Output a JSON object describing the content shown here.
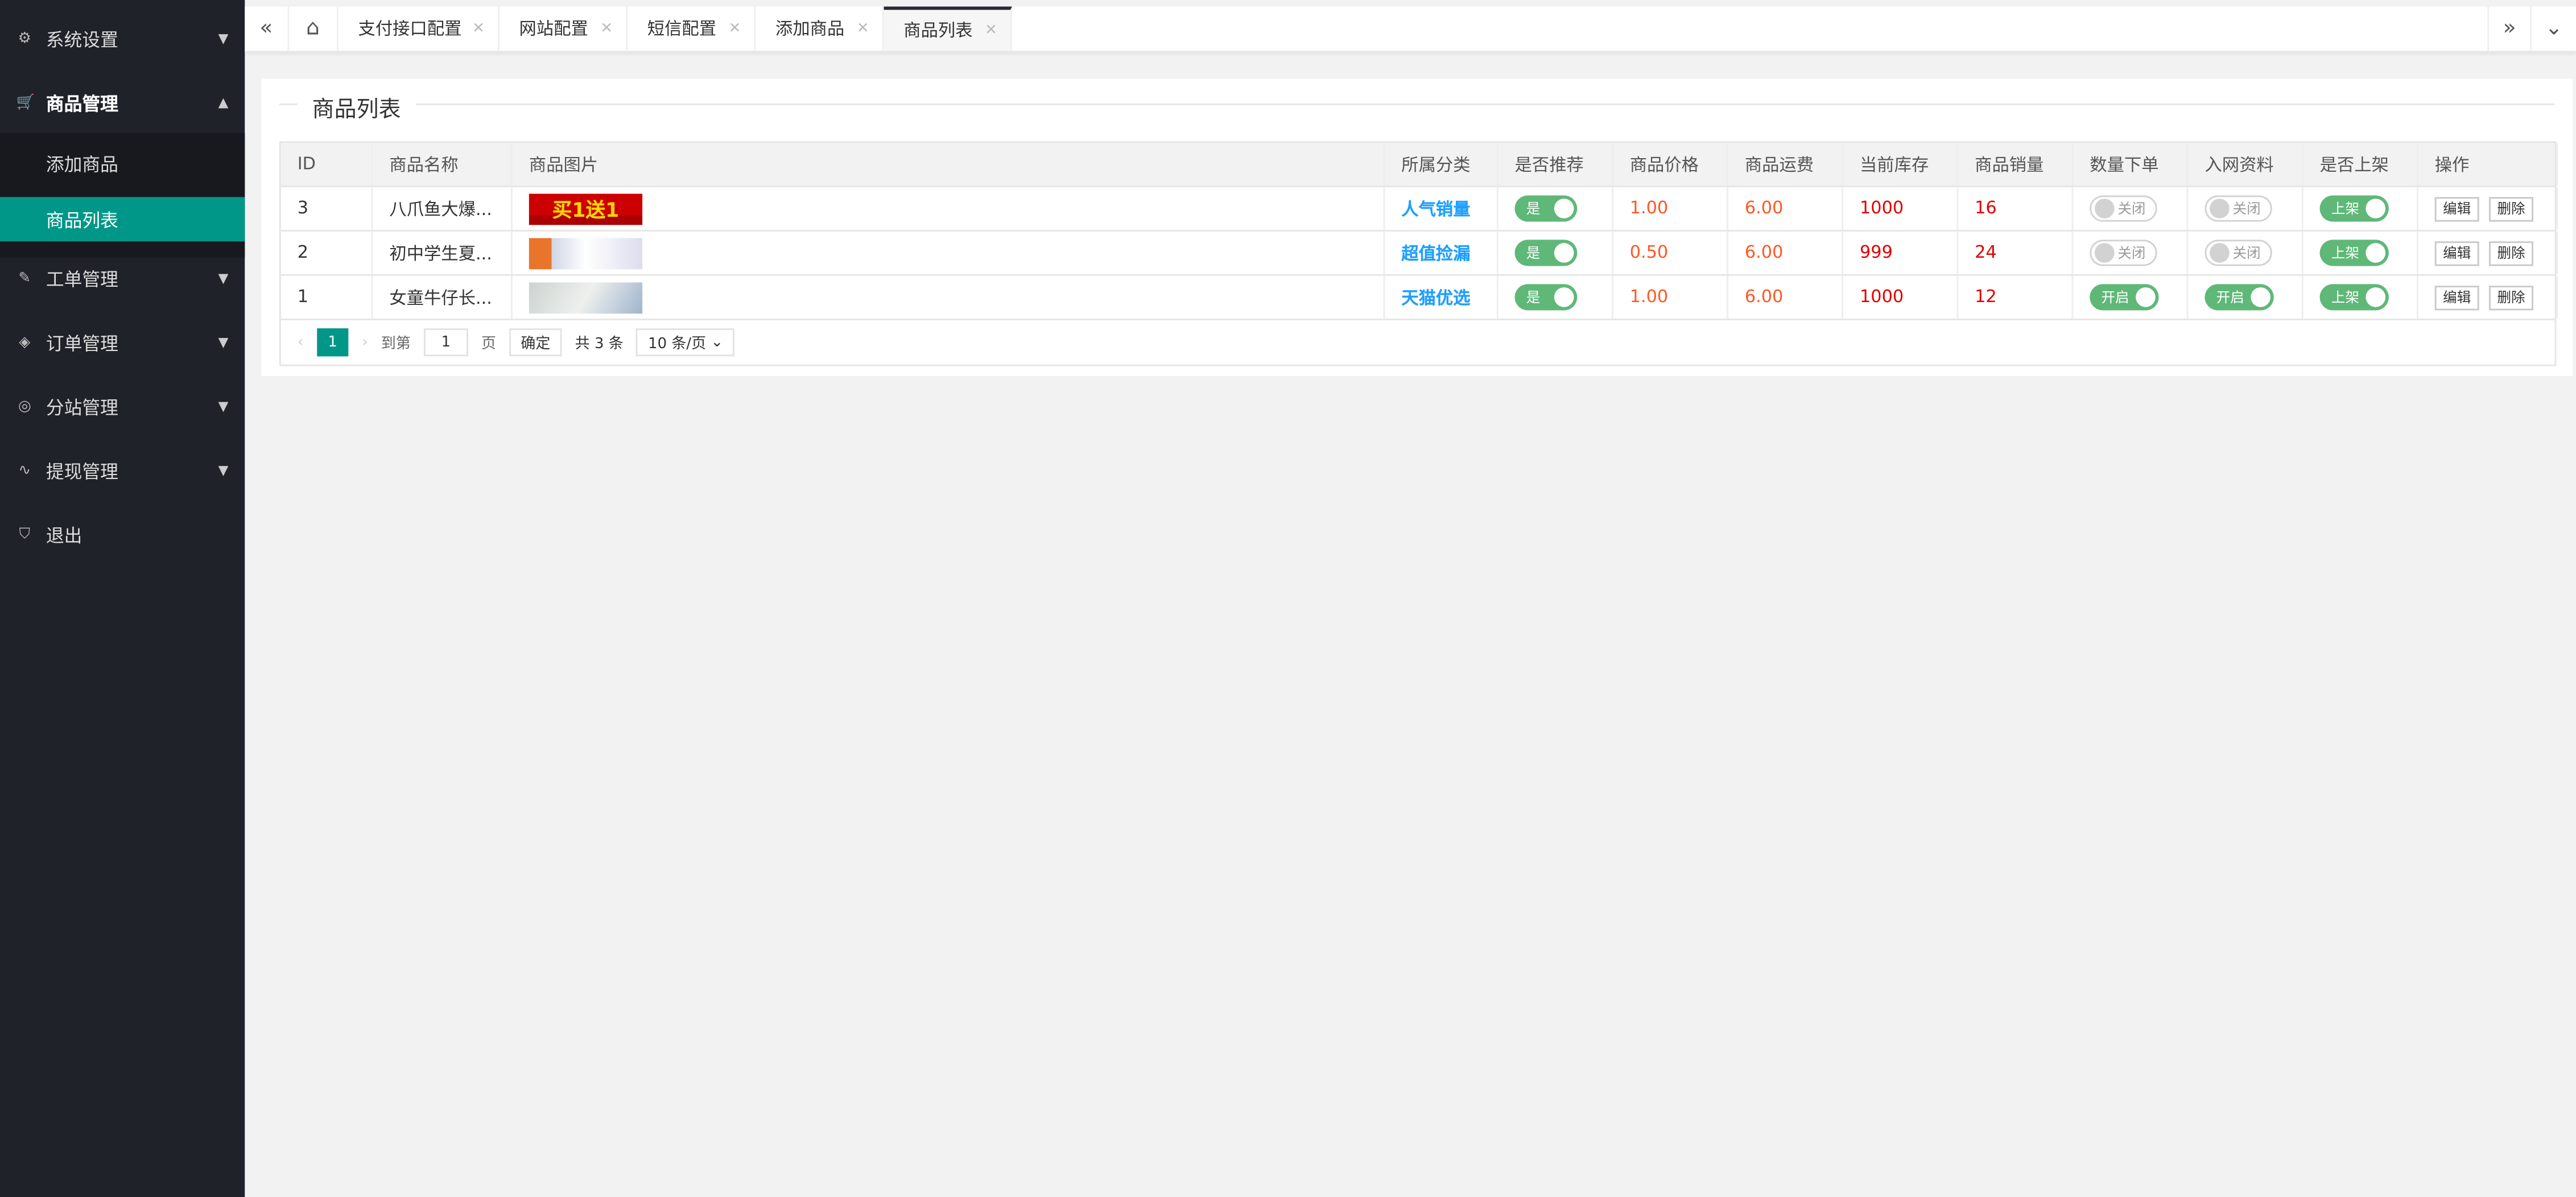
{
  "sidebar": {
    "items": [
      {
        "label": "系统设置",
        "icon": "gear-icon",
        "open": false
      },
      {
        "label": "商品管理",
        "icon": "cart-icon",
        "open": true,
        "children": [
          {
            "label": "添加商品",
            "active": false
          },
          {
            "label": "商品列表",
            "active": true
          }
        ]
      },
      {
        "label": "工单管理",
        "icon": "ticket-icon",
        "open": false
      },
      {
        "label": "订单管理",
        "icon": "layers-icon",
        "open": false
      },
      {
        "label": "分站管理",
        "icon": "globe-icon",
        "open": false
      },
      {
        "label": "提现管理",
        "icon": "pulse-icon",
        "open": false
      },
      {
        "label": "退出",
        "icon": "shield-icon"
      }
    ]
  },
  "tabs": [
    {
      "label": "支付接口配置"
    },
    {
      "label": "网站配置"
    },
    {
      "label": "短信配置"
    },
    {
      "label": "添加商品"
    },
    {
      "label": "商品列表",
      "active": true
    }
  ],
  "card": {
    "title": "商品列表"
  },
  "table": {
    "columns": [
      "ID",
      "商品名称",
      "商品图片",
      "所属分类",
      "是否推荐",
      "商品价格",
      "商品运费",
      "当前库存",
      "商品销量",
      "数量下单",
      "入网资料",
      "是否上架",
      "操作"
    ],
    "rows": [
      {
        "id": "3",
        "name": "八爪鱼大爆...",
        "image_text": "买1送1",
        "category": "人气销量",
        "recommend": "是",
        "price": "1.00",
        "shipping": "6.00",
        "stock": "1000",
        "sales": "16",
        "qty_order": "关闭",
        "qty_on": false,
        "net_info": "关闭",
        "net_on": false,
        "shelf": "上架",
        "edit": "编辑",
        "delete": "删除"
      },
      {
        "id": "2",
        "name": "初中学生夏...",
        "image_text": "",
        "category": "超值捡漏",
        "recommend": "是",
        "price": "0.50",
        "shipping": "6.00",
        "stock": "999",
        "sales": "24",
        "qty_order": "关闭",
        "qty_on": false,
        "net_info": "关闭",
        "net_on": false,
        "shelf": "上架",
        "edit": "编辑",
        "delete": "删除"
      },
      {
        "id": "1",
        "name": "女童牛仔长...",
        "image_text": "",
        "category": "天猫优选",
        "recommend": "是",
        "price": "1.00",
        "shipping": "6.00",
        "stock": "1000",
        "sales": "12",
        "qty_order": "开启",
        "qty_on": true,
        "net_info": "开启",
        "net_on": true,
        "shelf": "上架",
        "edit": "编辑",
        "delete": "删除"
      }
    ]
  },
  "pagination": {
    "current": "1",
    "goto_label": "到第",
    "page_input": "1",
    "page_unit": "页",
    "confirm": "确定",
    "total": "共 3 条",
    "page_size": "10 条/页"
  },
  "colors": {
    "accent": "#009688",
    "switch_on": "#5fb878",
    "category": "#1e9fff",
    "price": "#ff5722",
    "stock": "#e00000",
    "sidebar": "#20222a"
  }
}
